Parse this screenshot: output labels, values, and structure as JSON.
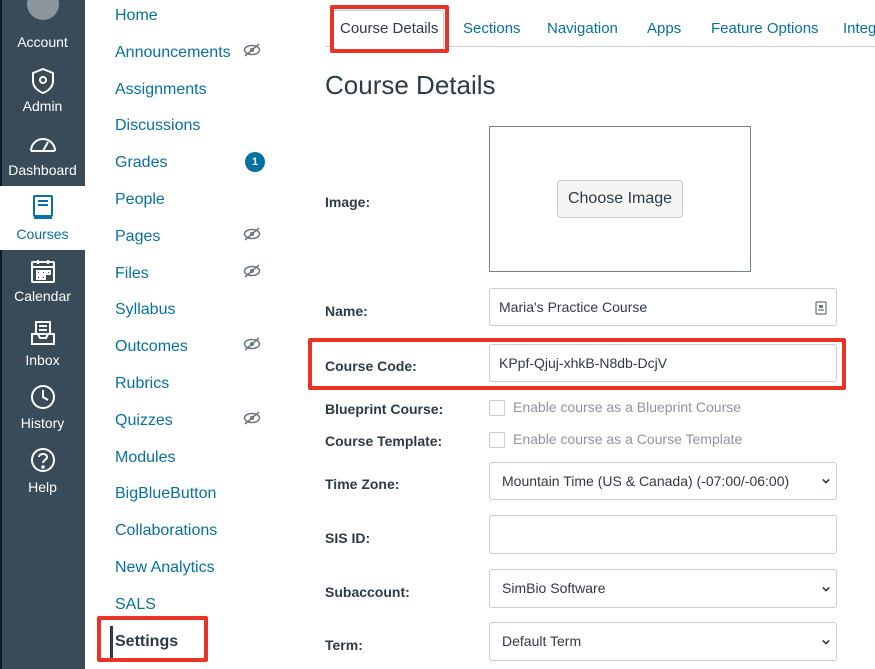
{
  "global_nav": {
    "items": [
      {
        "label": "Account",
        "icon": "account-icon"
      },
      {
        "label": "Admin",
        "icon": "admin-icon"
      },
      {
        "label": "Dashboard",
        "icon": "dashboard-icon"
      },
      {
        "label": "Courses",
        "icon": "courses-icon",
        "active": true
      },
      {
        "label": "Calendar",
        "icon": "calendar-icon"
      },
      {
        "label": "Inbox",
        "icon": "inbox-icon"
      },
      {
        "label": "History",
        "icon": "history-icon"
      },
      {
        "label": "Help",
        "icon": "help-icon"
      }
    ]
  },
  "course_nav": {
    "items": [
      {
        "label": "Home"
      },
      {
        "label": "Announcements",
        "hidden_icon": true
      },
      {
        "label": "Assignments"
      },
      {
        "label": "Discussions"
      },
      {
        "label": "Grades",
        "badge": "1"
      },
      {
        "label": "People"
      },
      {
        "label": "Pages",
        "hidden_icon": true
      },
      {
        "label": "Files",
        "hidden_icon": true
      },
      {
        "label": "Syllabus"
      },
      {
        "label": "Outcomes",
        "hidden_icon": true
      },
      {
        "label": "Rubrics"
      },
      {
        "label": "Quizzes",
        "hidden_icon": true
      },
      {
        "label": "Modules"
      },
      {
        "label": "BigBlueButton"
      },
      {
        "label": "Collaborations"
      },
      {
        "label": "New Analytics"
      },
      {
        "label": "SALS"
      },
      {
        "label": "Settings",
        "current": true
      }
    ]
  },
  "tabs": [
    {
      "label": "Course Details",
      "active": true
    },
    {
      "label": "Sections"
    },
    {
      "label": "Navigation"
    },
    {
      "label": "Apps"
    },
    {
      "label": "Feature Options"
    },
    {
      "label": "Integ"
    }
  ],
  "page_title": "Course Details",
  "form": {
    "image_label": "Image:",
    "choose_image": "Choose Image",
    "name_label": "Name:",
    "name_value": "Maria's Practice Course",
    "code_label": "Course Code:",
    "code_value": "KPpf-Qjuj-xhkB-N8db-DcjV",
    "blueprint_label": "Blueprint Course:",
    "blueprint_text": "Enable course as a Blueprint Course",
    "template_label": "Course Template:",
    "template_text": "Enable course as a Course Template",
    "timezone_label": "Time Zone:",
    "timezone_value": "Mountain Time (US & Canada) (-07:00/-06:00)",
    "sis_label": "SIS ID:",
    "sis_value": "",
    "subaccount_label": "Subaccount:",
    "subaccount_value": "SimBio Software",
    "term_label": "Term:",
    "term_value": "Default Term"
  },
  "colors": {
    "nav_bg": "#394b58",
    "link": "#0770a3",
    "highlight": "#e93324"
  }
}
